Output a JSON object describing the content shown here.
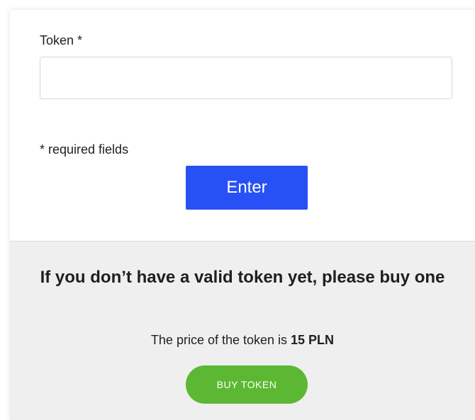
{
  "form": {
    "token_label": "Token *",
    "token_value": "",
    "token_placeholder": "",
    "required_note": "* required fields",
    "enter_label": "Enter"
  },
  "buy": {
    "heading": "If you don’t have a valid token yet, please buy one",
    "price_prefix": "The price of the token is ",
    "price_amount": "15 PLN",
    "buy_label": "BUY TOKEN"
  },
  "colors": {
    "primary_button": "#2750f5",
    "buy_button": "#5cb833",
    "buy_section_bg": "#efefef"
  }
}
